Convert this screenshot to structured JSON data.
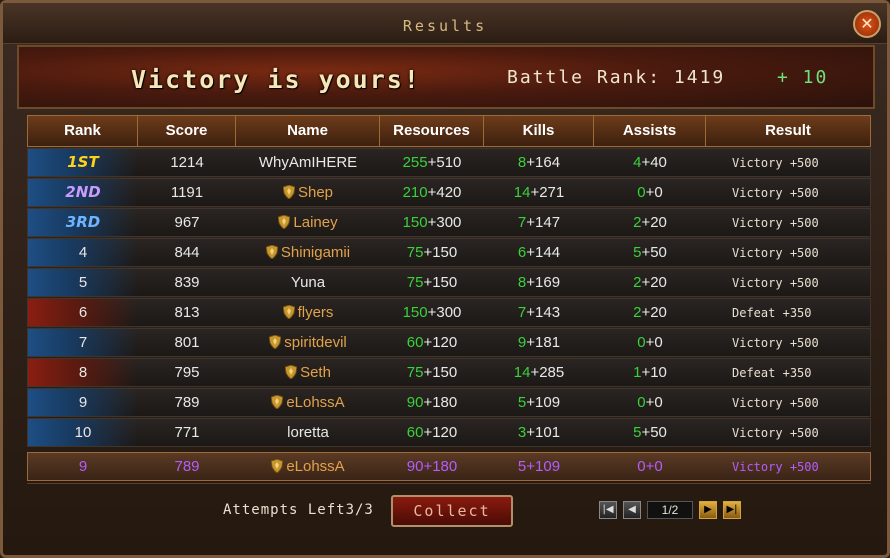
{
  "window": {
    "title": "Results",
    "close_icon": "close-icon"
  },
  "banner": {
    "headline": "Victory is yours!",
    "battle_rank_label": "Battle Rank:",
    "battle_rank_value": "1419",
    "rank_gain": "+ 10"
  },
  "table": {
    "headers": [
      "Rank",
      "Score",
      "Name",
      "Resources",
      "Kills",
      "Assists",
      "Result"
    ],
    "rows": [
      {
        "rank": "1ST",
        "score": "1214",
        "name": "WhyAmIHERE",
        "guild": false,
        "res_a": "255",
        "res_b": "+510",
        "kills_a": "8",
        "kills_b": "+164",
        "ast_a": "4",
        "ast_b": "+40",
        "result": "Victory",
        "bonus": "+500",
        "rank_style": "top1",
        "bg": "blue"
      },
      {
        "rank": "2ND",
        "score": "1191",
        "name": "Shep",
        "guild": true,
        "res_a": "210",
        "res_b": "+420",
        "kills_a": "14",
        "kills_b": "+271",
        "ast_a": "0",
        "ast_b": "+0",
        "result": "Victory",
        "bonus": "+500",
        "rank_style": "top2",
        "bg": "blue"
      },
      {
        "rank": "3RD",
        "score": "967",
        "name": "Lainey",
        "guild": true,
        "res_a": "150",
        "res_b": "+300",
        "kills_a": "7",
        "kills_b": "+147",
        "ast_a": "2",
        "ast_b": "+20",
        "result": "Victory",
        "bonus": "+500",
        "rank_style": "top3",
        "bg": "blue"
      },
      {
        "rank": "4",
        "score": "844",
        "name": "Shinigamii",
        "guild": true,
        "res_a": "75",
        "res_b": "+150",
        "kills_a": "6",
        "kills_b": "+144",
        "ast_a": "5",
        "ast_b": "+50",
        "result": "Victory",
        "bonus": "+500",
        "rank_style": "",
        "bg": "blue"
      },
      {
        "rank": "5",
        "score": "839",
        "name": "Yuna",
        "guild": false,
        "res_a": "75",
        "res_b": "+150",
        "kills_a": "8",
        "kills_b": "+169",
        "ast_a": "2",
        "ast_b": "+20",
        "result": "Victory",
        "bonus": "+500",
        "rank_style": "",
        "bg": "blue"
      },
      {
        "rank": "6",
        "score": "813",
        "name": "flyers",
        "guild": true,
        "res_a": "150",
        "res_b": "+300",
        "kills_a": "7",
        "kills_b": "+143",
        "ast_a": "2",
        "ast_b": "+20",
        "result": "Defeat",
        "bonus": "+350",
        "rank_style": "",
        "bg": "red"
      },
      {
        "rank": "7",
        "score": "801",
        "name": "spiritdevil",
        "guild": true,
        "res_a": "60",
        "res_b": "+120",
        "kills_a": "9",
        "kills_b": "+181",
        "ast_a": "0",
        "ast_b": "+0",
        "result": "Victory",
        "bonus": "+500",
        "rank_style": "",
        "bg": "blue"
      },
      {
        "rank": "8",
        "score": "795",
        "name": "Seth",
        "guild": true,
        "res_a": "75",
        "res_b": "+150",
        "kills_a": "14",
        "kills_b": "+285",
        "ast_a": "1",
        "ast_b": "+10",
        "result": "Defeat",
        "bonus": "+350",
        "rank_style": "",
        "bg": "red"
      },
      {
        "rank": "9",
        "score": "789",
        "name": "eLohssA",
        "guild": true,
        "res_a": "90",
        "res_b": "+180",
        "kills_a": "5",
        "kills_b": "+109",
        "ast_a": "0",
        "ast_b": "+0",
        "result": "Victory",
        "bonus": "+500",
        "rank_style": "",
        "bg": "blue"
      },
      {
        "rank": "10",
        "score": "771",
        "name": "loretta",
        "guild": false,
        "res_a": "60",
        "res_b": "+120",
        "kills_a": "3",
        "kills_b": "+101",
        "ast_a": "5",
        "ast_b": "+50",
        "result": "Victory",
        "bonus": "+500",
        "rank_style": "",
        "bg": "blue"
      }
    ],
    "self_row": {
      "rank": "9",
      "score": "789",
      "name": "eLohssA",
      "guild": true,
      "res_a": "90",
      "res_b": "+180",
      "kills_a": "5",
      "kills_b": "+109",
      "ast_a": "0",
      "ast_b": "+0",
      "result": "Victory",
      "bonus": "+500"
    }
  },
  "footer": {
    "attempts_label": "Attempts Left",
    "attempts_value": "3/3",
    "collect_label": "Collect",
    "pager": {
      "first": "|◀",
      "prev": "◀",
      "page": "1/2",
      "next": "▶",
      "last": "▶|"
    }
  },
  "colors": {
    "resource_green": "#39d23a",
    "self_purple": "#b45cff",
    "guild_gold": "#e0a24a",
    "accent": "#d8b883"
  }
}
